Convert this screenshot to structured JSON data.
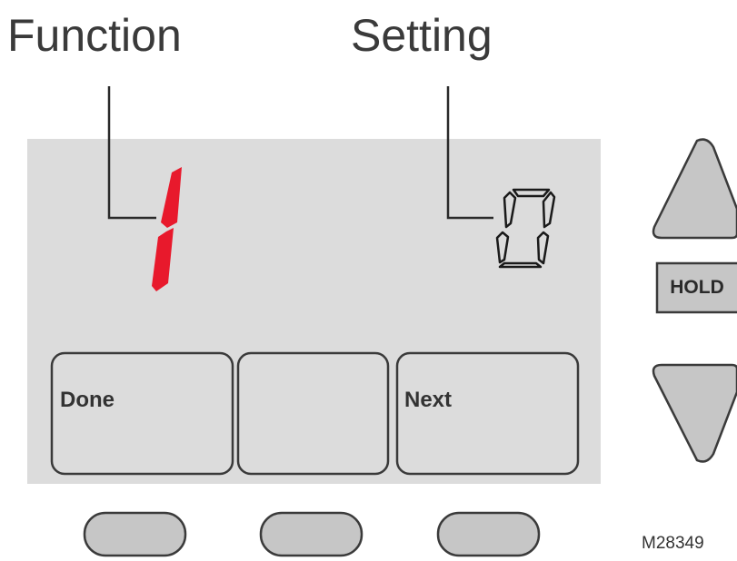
{
  "callouts": {
    "function": "Function",
    "setting": "Setting"
  },
  "display": {
    "function_value": "1",
    "setting_value": "0",
    "function_digit_color": "#e8192c",
    "setting_digit_color": "#1a1a1a"
  },
  "soft_keys": [
    {
      "label": "Done"
    },
    {
      "label": ""
    },
    {
      "label": "Next"
    }
  ],
  "side_buttons": {
    "up": "up-arrow-icon",
    "hold": "HOLD",
    "down": "down-arrow-icon"
  },
  "model_code": "M28349",
  "colors": {
    "screen": "#dcdcdc",
    "button_fill": "#c6c6c6",
    "outline": "#3a3a3a"
  }
}
